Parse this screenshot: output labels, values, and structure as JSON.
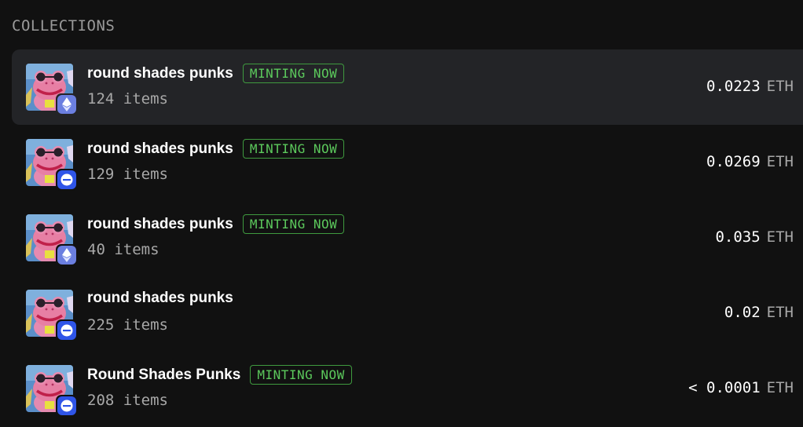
{
  "section_title": "COLLECTIONS",
  "colors": {
    "background": "#111111",
    "active_row": "#232427",
    "minting_badge": "#5cc95c",
    "eth_chain": "#6b7fe0",
    "base_chain": "#2f55e8"
  },
  "collections": [
    {
      "name": "round shades punks",
      "badge": "MINTING NOW",
      "count": "124 items",
      "price": "0.0223",
      "unit": "ETH",
      "chain_icon": "ethereum-icon"
    },
    {
      "name": "round shades punks",
      "badge": "MINTING NOW",
      "count": "129 items",
      "price": "0.0269",
      "unit": "ETH",
      "chain_icon": "base-icon"
    },
    {
      "name": "round shades punks",
      "badge": "MINTING NOW",
      "count": "40 items",
      "price": "0.035",
      "unit": "ETH",
      "chain_icon": "ethereum-icon"
    },
    {
      "name": "round shades punks",
      "badge": "",
      "count": "225 items",
      "price": "0.02",
      "unit": "ETH",
      "chain_icon": "base-icon"
    },
    {
      "name": "Round Shades Punks",
      "badge": "MINTING NOW",
      "count": "208 items",
      "price": "< 0.0001",
      "unit": "ETH",
      "chain_icon": "base-icon"
    }
  ]
}
